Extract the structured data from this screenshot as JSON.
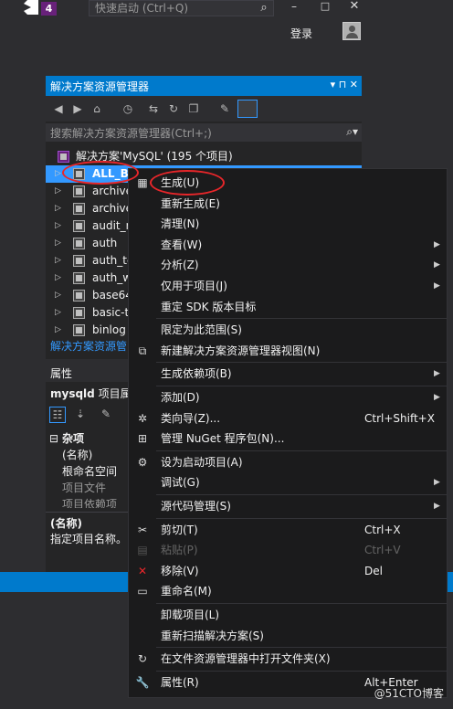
{
  "titlebar": {
    "vs_badge": "4",
    "quicklaunch_placeholder": "快速启动 (Ctrl+Q)",
    "minimize": "–",
    "maximize": "□",
    "close": "✕",
    "login": "登录"
  },
  "solution_explorer": {
    "title": "解决方案资源管理器",
    "header_buttons": "▾ ⊓ ✕",
    "search_placeholder": "搜索解决方案资源管理器(Ctrl+;)",
    "solution_label": "解决方案'MySQL' (195 个项目)",
    "items": [
      {
        "label": "ALL_B",
        "selected": true
      },
      {
        "label": "archive"
      },
      {
        "label": "archive"
      },
      {
        "label": "audit_r"
      },
      {
        "label": "auth"
      },
      {
        "label": "auth_te"
      },
      {
        "label": "auth_w"
      },
      {
        "label": "base64"
      },
      {
        "label": "basic-t"
      },
      {
        "label": "binlog"
      }
    ],
    "footer": "解决方案资源管"
  },
  "properties": {
    "title": "属性",
    "object": "mysqld",
    "object_suffix": "项目属",
    "group": "杂项",
    "rows": [
      "(名称)",
      "根命名空间",
      "项目文件",
      "项目依赖项"
    ],
    "desc_title": "(名称)",
    "desc_text": "指定项目名称。"
  },
  "context_menu": {
    "items": [
      {
        "label": "生成(U)",
        "icon": "build-icon",
        "glyph": "▦"
      },
      {
        "label": "重新生成(E)"
      },
      {
        "label": "清理(N)"
      },
      {
        "label": "查看(W)",
        "submenu": true
      },
      {
        "label": "分析(Z)",
        "submenu": true
      },
      {
        "label": "仅用于项目(J)",
        "submenu": true
      },
      {
        "label": "重定 SDK 版本目标"
      },
      {
        "sep": true
      },
      {
        "label": "限定为此范围(S)"
      },
      {
        "label": "新建解决方案资源管理器视图(N)",
        "icon": "new-view-icon",
        "glyph": "⧉"
      },
      {
        "sep": true
      },
      {
        "label": "生成依赖项(B)",
        "submenu": true
      },
      {
        "sep": true
      },
      {
        "label": "添加(D)",
        "submenu": true
      },
      {
        "label": "类向导(Z)...",
        "icon": "class-wizard-icon",
        "glyph": "✲",
        "key": "Ctrl+Shift+X"
      },
      {
        "label": "管理 NuGet 程序包(N)...",
        "icon": "nuget-icon",
        "glyph": "⊞"
      },
      {
        "sep": true
      },
      {
        "label": "设为启动项目(A)",
        "icon": "gear-icon",
        "glyph": "⚙"
      },
      {
        "label": "调试(G)",
        "submenu": true
      },
      {
        "sep": true
      },
      {
        "label": "源代码管理(S)",
        "submenu": true
      },
      {
        "sep": true
      },
      {
        "label": "剪切(T)",
        "icon": "scissors-icon",
        "glyph": "✂",
        "key": "Ctrl+X"
      },
      {
        "label": "粘贴(P)",
        "icon": "paste-icon",
        "glyph": "▤",
        "key": "Ctrl+V",
        "disabled": true
      },
      {
        "label": "移除(V)",
        "icon": "remove-icon",
        "glyph": "✕",
        "key": "Del",
        "red": true
      },
      {
        "label": "重命名(M)",
        "icon": "rename-icon",
        "glyph": "▭"
      },
      {
        "sep": true
      },
      {
        "label": "卸载项目(L)"
      },
      {
        "label": "重新扫描解决方案(S)"
      },
      {
        "sep": true
      },
      {
        "label": "在文件资源管理器中打开文件夹(X)",
        "icon": "open-folder-icon",
        "glyph": "↻"
      },
      {
        "sep": true
      },
      {
        "label": "属性(R)",
        "icon": "wrench-icon",
        "glyph": "🔧",
        "key": "Alt+Enter"
      }
    ]
  },
  "watermark": "@51CTO博客"
}
